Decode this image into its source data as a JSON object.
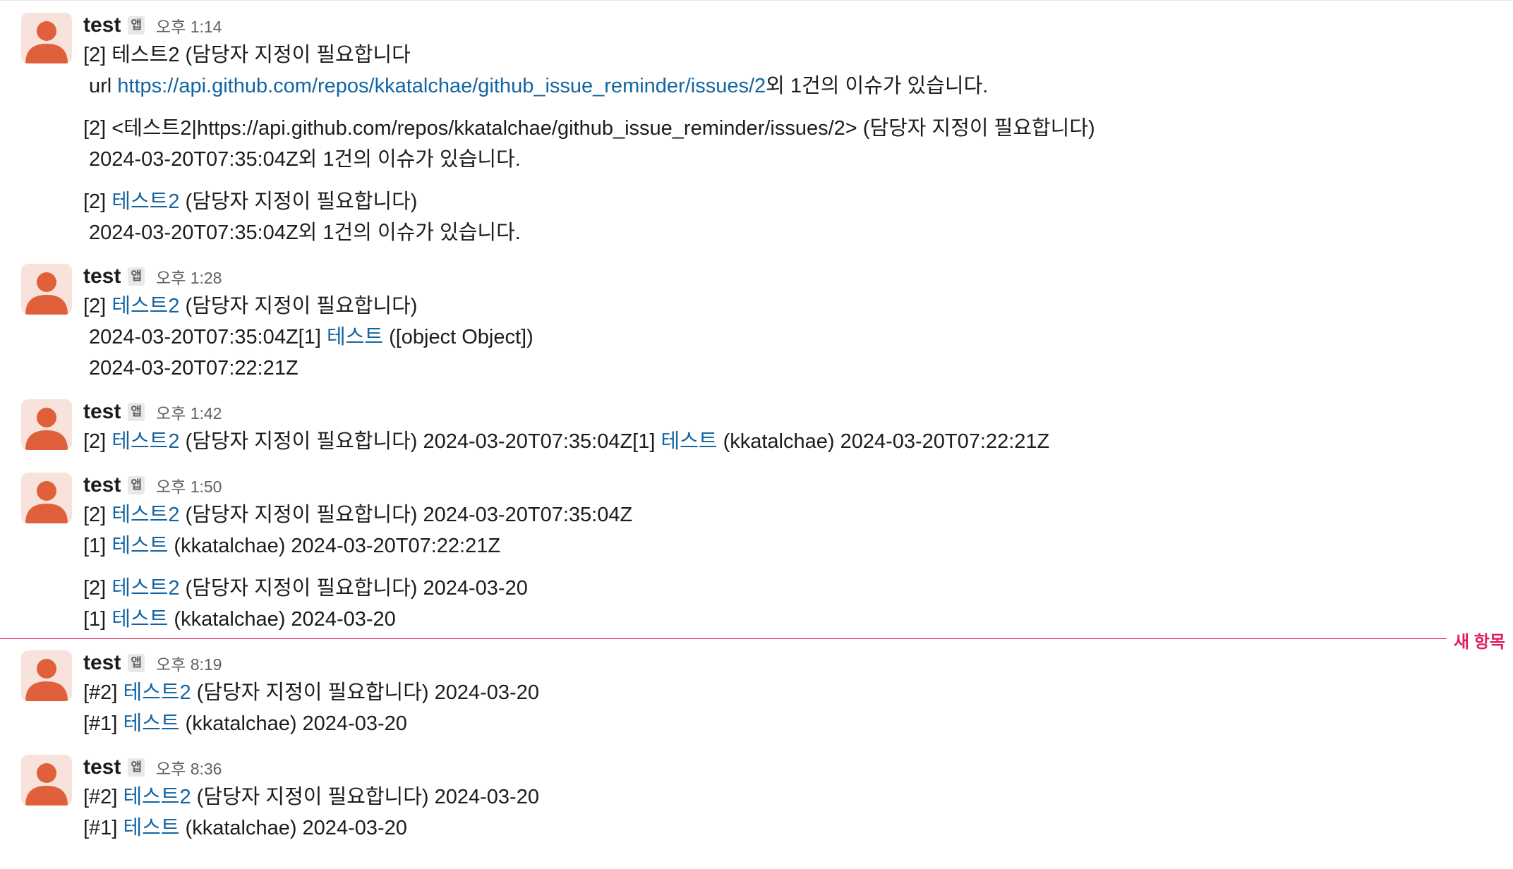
{
  "colors": {
    "link": "#1264a3",
    "new_divider": "#e01e5a",
    "avatar_fg": "#e0603b",
    "avatar_bg": "#f8e3dc",
    "badge_bg": "#e8e8e8"
  },
  "new_items_label": "새 항목",
  "messages": [
    {
      "sender": "test",
      "badge": "앱",
      "time": "오후 1:14",
      "blocks": [
        {
          "a": "[2] 테스트2 (담당자 지정이 필요합니다"
        },
        {
          "a": "url ",
          "link": "https://api.github.com/repos/kkatalchae/github_issue_reminder/issues/2",
          "b": "외 1건의 이슈가 있습니다."
        },
        {
          "a": "[2] <테스트2|https://api.github.com/repos/kkatalchae/github_issue_reminder/issues/2> (담당자 지정이 필요합니다)"
        },
        {
          "a": "2024-03-20T07:35:04Z외 1건의 이슈가 있습니다."
        },
        {
          "a": "[2] ",
          "link": "테스트2",
          "b": " (담당자 지정이 필요합니다)"
        },
        {
          "a": "2024-03-20T07:35:04Z외 1건의 이슈가 있습니다."
        }
      ]
    },
    {
      "sender": "test",
      "badge": "앱",
      "time": "오후 1:28",
      "blocks": [
        {
          "a": "[2] ",
          "link": "테스트2",
          "b": " (담당자 지정이 필요합니다)"
        },
        {
          "a": "2024-03-20T07:35:04Z[1] ",
          "link": "테스트",
          "b": " ([object Object])"
        },
        {
          "a": "2024-03-20T07:22:21Z"
        }
      ]
    },
    {
      "sender": "test",
      "badge": "앱",
      "time": "오후 1:42",
      "blocks": [
        {
          "a": "[2] ",
          "link": "테스트2",
          "b": " (담당자 지정이 필요합니다) 2024-03-20T07:35:04Z[1] ",
          "link2": "테스트",
          "c": " (kkatalchae) 2024-03-20T07:22:21Z"
        }
      ]
    },
    {
      "sender": "test",
      "badge": "앱",
      "time": "오후 1:50",
      "blocks": [
        {
          "a": "[2] ",
          "link": "테스트2",
          "b": " (담당자 지정이 필요합니다) 2024-03-20T07:35:04Z"
        },
        {
          "a": "[1] ",
          "link": "테스트",
          "b": " (kkatalchae) 2024-03-20T07:22:21Z"
        },
        {
          "a": "[2] ",
          "link": "테스트2",
          "b": " (담당자 지정이 필요합니다) 2024-03-20"
        },
        {
          "a": "[1] ",
          "link": "테스트",
          "b": " (kkatalchae) 2024-03-20"
        }
      ]
    },
    {
      "sender": "test",
      "badge": "앱",
      "time": "오후 8:19",
      "blocks": [
        {
          "a": "[#2] ",
          "link": "테스트2",
          "b": " (담당자 지정이 필요합니다) 2024-03-20"
        },
        {
          "a": "[#1] ",
          "link": "테스트",
          "b": " (kkatalchae) 2024-03-20"
        }
      ]
    },
    {
      "sender": "test",
      "badge": "앱",
      "time": "오후 8:36",
      "blocks": [
        {
          "a": "[#2] ",
          "link": "테스트2",
          "b": " (담당자 지정이 필요합니다) 2024-03-20"
        },
        {
          "a": "[#1] ",
          "link": "테스트",
          "b": " (kkatalchae) 2024-03-20"
        }
      ]
    }
  ]
}
